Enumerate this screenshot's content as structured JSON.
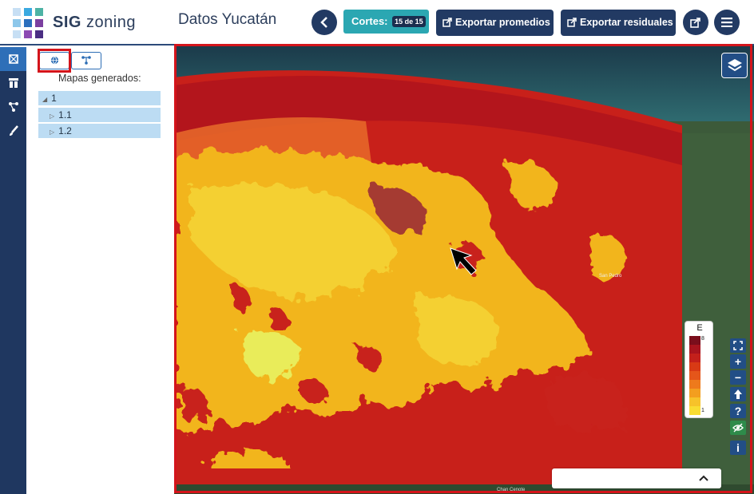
{
  "app": {
    "logo_part1": "SIG",
    "logo_part2": "zoning",
    "title": "Datos Yucatán"
  },
  "header": {
    "back_icon": "chevron-left-icon",
    "cortes_label": "Cortes:",
    "cortes_badge": "15 de 15",
    "export_promedios": "Exportar promedios",
    "export_residuales": "Exportar residuales",
    "share_icon": "share-icon",
    "menu_icon": "hamburger-icon"
  },
  "colors": {
    "navy": "#223a63",
    "teal": "#2ba7b2",
    "highlight": "#d4141b",
    "tree_bg": "#bcdcf3"
  },
  "leftbar": {
    "items": [
      "map-icon",
      "columns-icon",
      "network-icon",
      "brush-icon"
    ]
  },
  "sidepanel": {
    "tabs": [
      "globe-icon",
      "tree-icon"
    ],
    "label": "Mapas generados:",
    "tree": [
      {
        "label": "1",
        "level": 0,
        "expanded": true
      },
      {
        "label": "1.1",
        "level": 1,
        "expanded": false
      },
      {
        "label": "1.2",
        "level": 1,
        "expanded": false
      }
    ]
  },
  "map": {
    "legend_title": "E",
    "legend_max": "8",
    "legend_min": "1",
    "legend_colors": [
      "#7a0e1c",
      "#a8141e",
      "#c3201b",
      "#d83a15",
      "#e5561a",
      "#ee7a1c",
      "#f39e1f",
      "#f7c22a",
      "#f9dc32"
    ],
    "controls": [
      "fullscreen-icon",
      "zoom-in-icon",
      "zoom-out-icon",
      "north-arrow-icon",
      "help-icon",
      "visibility-icon",
      "info-icon"
    ],
    "place_labels": [
      "San Pedro",
      "Chan Cenote"
    ]
  }
}
